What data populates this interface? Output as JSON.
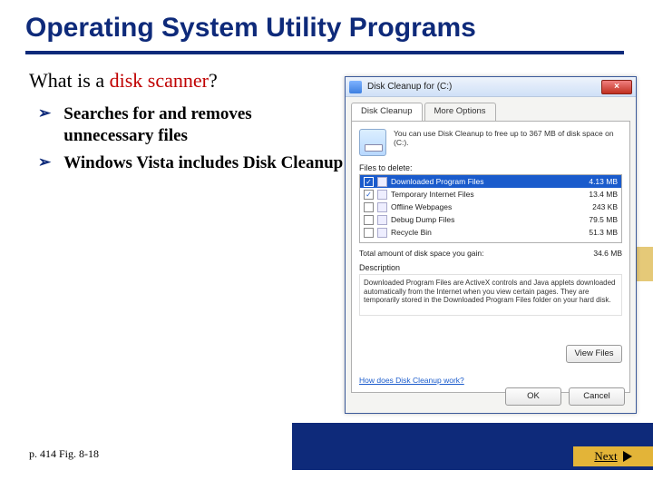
{
  "slide": {
    "title": "Operating System Utility Programs",
    "question_prefix": "What is a ",
    "question_key": "disk scanner",
    "question_suffix": "?",
    "bullets": [
      "Searches for and removes unnecessary files",
      "Windows Vista includes Disk Cleanup"
    ],
    "page_ref": "p. 414 Fig. 8-18",
    "next_label": "Next"
  },
  "dialog": {
    "title": "Disk Cleanup for  (C:)",
    "close": "×",
    "tabs": {
      "active": "Disk Cleanup",
      "other": "More Options"
    },
    "intro": "You can use Disk Cleanup to free up to 367 MB of disk space on  (C:).",
    "files_label": "Files to delete:",
    "files": [
      {
        "name": "Downloaded Program Files",
        "size": "4.13 MB",
        "checked": true,
        "selected": true
      },
      {
        "name": "Temporary Internet Files",
        "size": "13.4 MB",
        "checked": true,
        "selected": false
      },
      {
        "name": "Offline Webpages",
        "size": "243 KB",
        "checked": false,
        "selected": false
      },
      {
        "name": "Debug Dump Files",
        "size": "79.5 MB",
        "checked": false,
        "selected": false
      },
      {
        "name": "Recycle Bin",
        "size": "51.3 MB",
        "checked": false,
        "selected": false
      }
    ],
    "total_label": "Total amount of disk space you gain:",
    "total_value": "34.6 MB",
    "desc_label": "Description",
    "desc_text": "Downloaded Program Files are ActiveX controls and Java applets downloaded automatically from the Internet when you view certain pages. They are temporarily stored in the Downloaded Program Files folder on your hard disk.",
    "view_files": "View Files",
    "how_link": "How does Disk Cleanup work?",
    "ok": "OK",
    "cancel": "Cancel"
  }
}
